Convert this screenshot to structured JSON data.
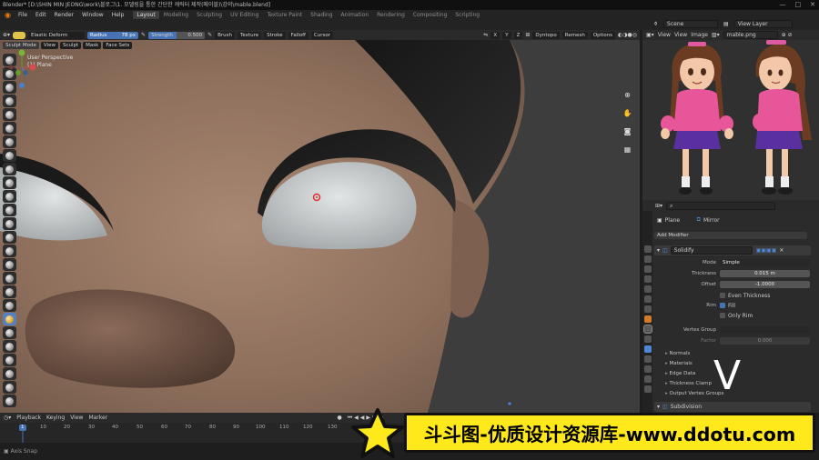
{
  "titlebar": {
    "title": "Blender* [D:\\SHIN MIN JEONG\\work\\블로그\\1. 모델링을 통한 간단한 캐릭터 제작(메이블)\\강의\\mable.blend]",
    "minimize": "—",
    "maximize": "□",
    "close": "✕"
  },
  "menubar": {
    "items": [
      "File",
      "Edit",
      "Render",
      "Window",
      "Help"
    ],
    "workspaces": [
      "Layout",
      "Modeling",
      "Sculpting",
      "UV Editing",
      "Texture Paint",
      "Shading",
      "Animation",
      "Rendering",
      "Compositing",
      "Scripting"
    ],
    "active_workspace": "Layout",
    "scene": "Scene",
    "view_layer": "View Layer"
  },
  "tool_header": {
    "brush_name": "Elastic Deform",
    "radius_label": "Radius",
    "radius_value": "78 px",
    "strength_label": "Strength",
    "strength_value": "0.500",
    "brush": "Brush",
    "texture": "Texture",
    "stroke": "Stroke",
    "falloff": "Falloff",
    "cursor": "Cursor",
    "axes": [
      "X",
      "Y",
      "Z"
    ],
    "dyntopo": "Dyntopo",
    "remesh": "Remesh",
    "options": "Options"
  },
  "mode_header": {
    "mode": "Sculpt Mode",
    "view": "View",
    "sculpt": "Sculpt",
    "mask": "Mask",
    "face_sets": "Face Sets"
  },
  "viewport": {
    "perspective": "User Perspective",
    "object": "(1) Plane"
  },
  "image_editor": {
    "view": "View",
    "view2": "View",
    "image": "Image",
    "filename": "mable.png"
  },
  "properties": {
    "object_name": "Plane",
    "modifier_name_tag": "Mirror",
    "add_modifier": "Add Modifier",
    "modifier": "Solidify",
    "mode_label": "Mode",
    "mode_value": "Simple",
    "thickness_label": "Thickness",
    "thickness_value": "0.015 m",
    "offset_label": "Offset",
    "offset_value": "-1.0000",
    "even_thickness": "Even Thickness",
    "rim_label": "Rim",
    "fill": "Fill",
    "only_rim": "Only Rim",
    "vertex_group_label": "Vertex Group",
    "factor_label": "Factor",
    "factor_value": "0.000",
    "panels": [
      "Normals",
      "Materials",
      "Edge Data",
      "Thickness Clamp",
      "Output Vertex Groups"
    ],
    "next_modifier": "Subdivision"
  },
  "timeline": {
    "playback": "Playback",
    "keying": "Keying",
    "view": "View",
    "marker": "Marker",
    "current_frame": "1",
    "ticks": [
      "10",
      "20",
      "30",
      "40",
      "50",
      "60",
      "70",
      "80",
      "90",
      "100",
      "110",
      "120",
      "130"
    ]
  },
  "status": {
    "text": "Axis Snap"
  },
  "overlay_letter": "V",
  "watermark": {
    "text": "斗斗图-优质设计资源库-www.ddotu.com"
  }
}
